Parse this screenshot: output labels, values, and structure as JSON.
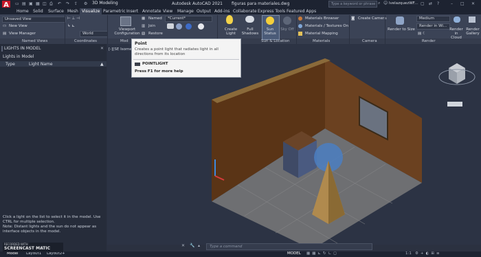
{
  "titlebar": {
    "workspace": "3D Modeling",
    "app_title": "Autodesk AutoCAD 2021",
    "file_name": "figuras para materiales.dwg",
    "search_placeholder": "Type a keyword or phrase",
    "user": "lvelazquezWF..."
  },
  "menu": [
    "Home",
    "Solid",
    "Surface",
    "Mesh",
    "Visualize",
    "Parametric",
    "Insert",
    "Annotate",
    "View",
    "Manage",
    "Output",
    "Add-ins",
    "Collaborate",
    "Express Tools",
    "Featured Apps"
  ],
  "menu_active": "Visualize",
  "ribbon": {
    "named_views": {
      "current": "Unsaved View",
      "new_view": "New View",
      "view_manager": "View Manager",
      "title": "Named Views"
    },
    "coordinates": {
      "ucs": "World",
      "title": "Coordinates"
    },
    "model_viewports": {
      "label": "Viewport Configuration",
      "title": "Mod"
    },
    "viewport_tools": {
      "named": "Named",
      "current": "*Current*",
      "join": "Join",
      "restore": "Restore"
    },
    "lights": {
      "create": "Create Light",
      "full_shadows": "Full Shadows"
    },
    "sun": {
      "status": "Sun Status",
      "sky_off": "Sky Off",
      "title": "Sun & Location"
    },
    "materials": {
      "browser": "Materials Browser",
      "textures": "Materials / Textures On",
      "mapping": "Material Mapping",
      "title": "Materials"
    },
    "camera": {
      "create": "Create Camera",
      "title": "Camera"
    },
    "render": {
      "quality": "Medium",
      "target": "Render in Wi...",
      "render_to_size": "Render to Size",
      "render_cloud": "Render in Cloud",
      "gallery": "Render Gallery",
      "title": "Render"
    }
  },
  "tooltip": {
    "title": "Point",
    "description": "Creates a point light that radiates light in all directions from its location",
    "command": "POINTLIGHT",
    "help": "Press F1 for more help"
  },
  "panel": {
    "title": "LIGHTS IN MODEL",
    "subtitle": "Lights in Model",
    "col_type": "Type",
    "col_name": "Light Name",
    "help1": "Click a light on the list to select it in the model. Use CTRL for multiple selection.",
    "help2": "Note: Distant lights and the sun do not appear as interface objects in the model."
  },
  "viewport": {
    "label": "[-][SE Isometric][..."
  },
  "command_placeholder": "Type a command",
  "status": {
    "model_tab": "Model",
    "layout1": "Layout1",
    "layout2": "Layout2",
    "model_space": "MODEL",
    "scale": "1:1"
  },
  "watermark": {
    "recorded": "RECORDED WITH",
    "brand": "SCREENCAST MATIC"
  }
}
